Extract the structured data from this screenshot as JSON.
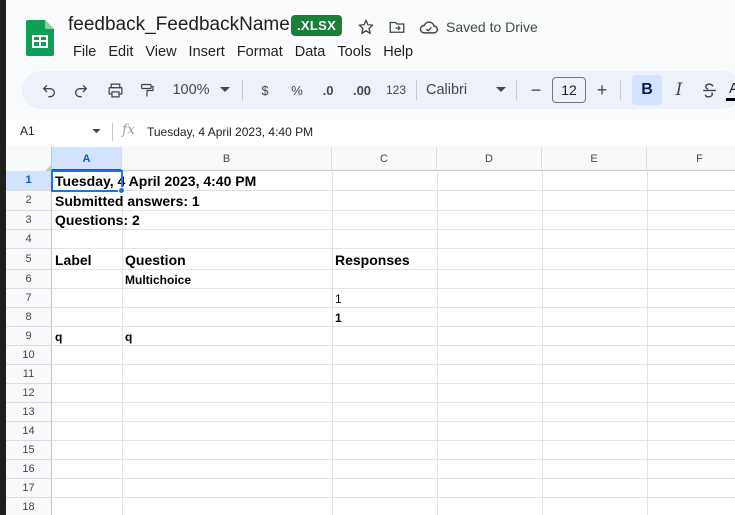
{
  "doc": {
    "title": "feedback_FeedbackName",
    "badge": ".XLSX",
    "saved_status": "Saved to Drive"
  },
  "menu": [
    "File",
    "Edit",
    "View",
    "Insert",
    "Format",
    "Data",
    "Tools",
    "Help"
  ],
  "toolbar": {
    "zoom": "100%",
    "currency": "$",
    "percent": "%",
    "dec_decrease": ".0",
    "dec_increase": ".00",
    "format_123": "123",
    "font": "Calibri",
    "font_size": "12",
    "minus": "−",
    "plus": "+",
    "bold": "B",
    "italic": "I",
    "text_color": "A"
  },
  "formula_bar": {
    "cell_ref": "A1",
    "fx": "fx",
    "content": "Tuesday, 4 April 2023, 4:40 PM"
  },
  "columns": [
    "A",
    "B",
    "C",
    "D",
    "E",
    "F"
  ],
  "rows": [
    "1",
    "2",
    "3",
    "4",
    "5",
    "6",
    "7",
    "8",
    "9",
    "10",
    "11",
    "12",
    "13",
    "14",
    "15",
    "16",
    "17",
    "18"
  ],
  "cells": {
    "A1": "Tuesday, 4 April 2023, 4:40 PM",
    "A2": "Submitted answers: 1",
    "A3": "Questions: 2",
    "A5": "Label",
    "B5": "Question",
    "C5": "Responses",
    "B6": "Multichoice",
    "C7": "1",
    "C8": "1",
    "A9": "q",
    "B9": "q"
  },
  "colors": {
    "accent": "#1a73e8",
    "badge": "#188038",
    "toolbar_bg": "#edf2fa"
  }
}
